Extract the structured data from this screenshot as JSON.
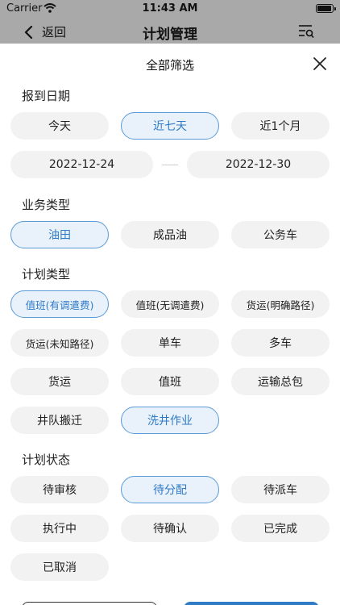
{
  "status_bar": {
    "carrier": "Carrier",
    "time": "11:43 AM"
  },
  "nav": {
    "back_label": "返回",
    "title": "计划管理"
  },
  "sheet": {
    "title": "全部筛选",
    "report_date": {
      "label": "报到日期",
      "chips": [
        "今天",
        "近七天",
        "近1个月"
      ],
      "selected": "近七天",
      "start_date": "2022-12-24",
      "end_date": "2022-12-30"
    },
    "business_type": {
      "label": "业务类型",
      "chips": [
        "油田",
        "成品油",
        "公务车"
      ],
      "selected": "油田"
    },
    "plan_type": {
      "label": "计划类型",
      "chips": [
        "值班(有调遣费)",
        "值班(无调遣费)",
        "货运(明确路径)",
        "货运(未知路径)",
        "单车",
        "多车",
        "货运",
        "值班",
        "运输总包",
        "井队搬迁",
        "洗井作业"
      ],
      "selected": [
        "值班(有调遣费)",
        "洗井作业"
      ]
    },
    "plan_status": {
      "label": "计划状态",
      "chips": [
        "待审核",
        "待分配",
        "待派车",
        "执行中",
        "待确认",
        "已完成",
        "已取消"
      ],
      "selected": "待分配"
    }
  },
  "colors": {
    "accent": "#2f7bc6",
    "chip_bg": "#f2f2f2",
    "selected_bg": "#e9f1fb",
    "overlay": "#a9a9a9"
  }
}
